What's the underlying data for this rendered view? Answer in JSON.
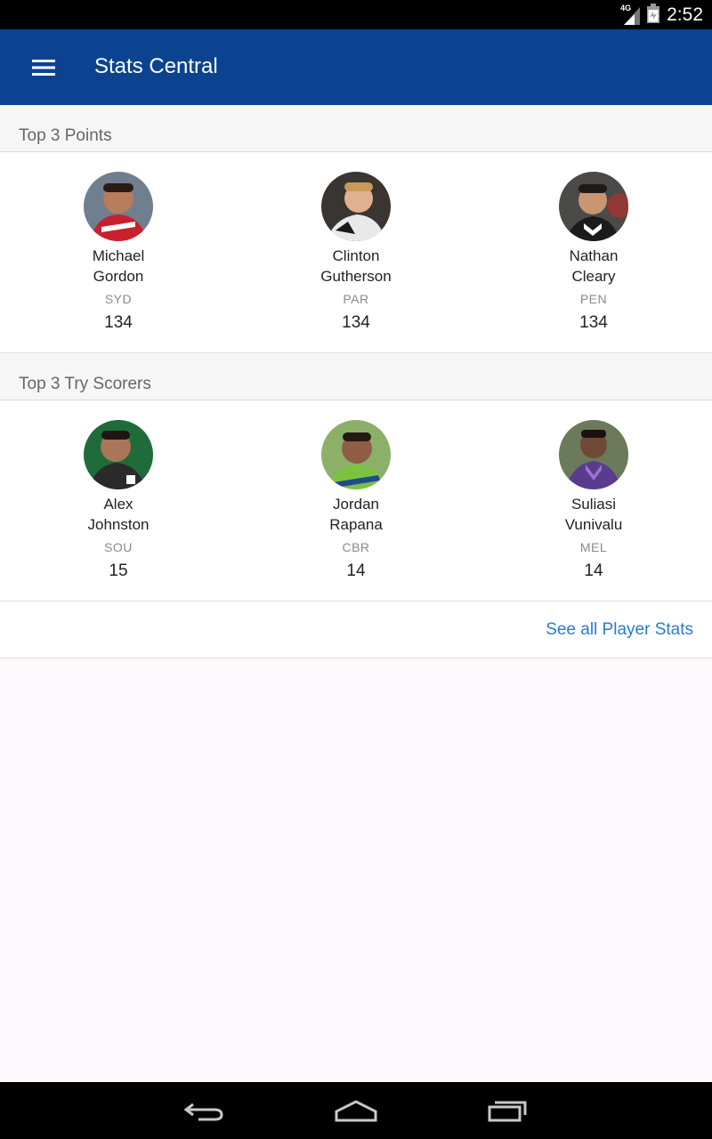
{
  "status_bar": {
    "network": "4G",
    "time": "2:52",
    "icons": [
      "signal-icon",
      "battery-icon"
    ]
  },
  "app_bar": {
    "title": "Stats Central",
    "menu_icon": "hamburger-menu-icon",
    "color": "#0b4391"
  },
  "sections": [
    {
      "title": "Top 3 Points",
      "players": [
        {
          "first": "Michael",
          "last": "Gordon",
          "team": "SYD",
          "value": "134",
          "jersey": "#c8202c",
          "jersey2": "#ffffff"
        },
        {
          "first": "Clinton",
          "last": "Gutherson",
          "team": "PAR",
          "value": "134",
          "jersey": "#e9e9e9",
          "jersey2": "#1a1a1a"
        },
        {
          "first": "Nathan",
          "last": "Cleary",
          "team": "PEN",
          "value": "134",
          "jersey": "#1b1b1b",
          "jersey2": "#b03030"
        }
      ]
    },
    {
      "title": "Top 3 Try Scorers",
      "players": [
        {
          "first": "Alex",
          "last": "Johnston",
          "team": "SOU",
          "value": "15",
          "jersey": "#2a2a2a",
          "jersey2": "#1f6b3a"
        },
        {
          "first": "Jordan",
          "last": "Rapana",
          "team": "CBR",
          "value": "14",
          "jersey": "#7cc242",
          "jersey2": "#1e4c8c"
        },
        {
          "first": "Suliasi",
          "last": "Vunivalu",
          "team": "MEL",
          "value": "14",
          "jersey": "#5a3c8e",
          "jersey2": "#a070d0"
        }
      ]
    }
  ],
  "see_all_label": "See all Player Stats",
  "colors": {
    "accent_link": "#2a7ad6",
    "background": "#fcf8fc"
  },
  "nav_bar": {
    "icons": [
      "back-icon",
      "home-icon",
      "recents-icon"
    ]
  }
}
